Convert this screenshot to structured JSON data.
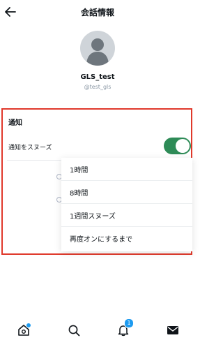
{
  "header": {
    "title": "会話情報"
  },
  "profile": {
    "display_name": "GLS_test",
    "username": "@test_gls"
  },
  "notifications": {
    "section_title": "通知",
    "snooze_label": "通知をスヌーズ",
    "snooze_enabled": true,
    "snooze_options": [
      "1時間",
      "8時間",
      "1週間スヌーズ",
      "再度オンにするまで"
    ]
  },
  "bottom_nav": {
    "notification_count": "1"
  },
  "colors": {
    "toggle_on": "#2e8b57",
    "highlight_border": "#e0392b",
    "accent": "#1d9bf0"
  }
}
